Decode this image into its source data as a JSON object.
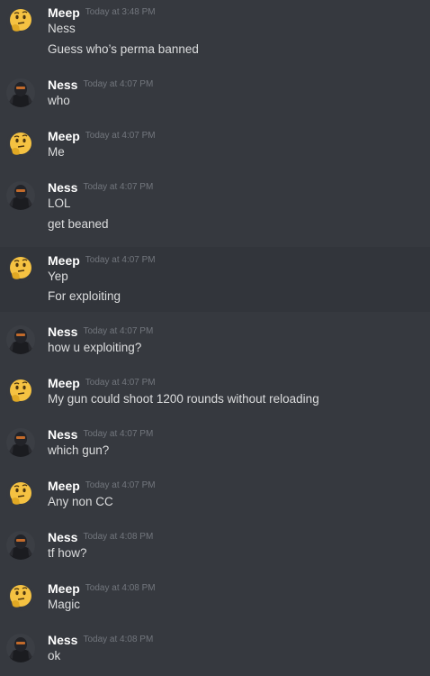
{
  "colors": {
    "background": "#36393f",
    "highlight_row": "#32353b",
    "username": "#ffffff",
    "message_text": "#dcddde",
    "timestamp": "#72767d"
  },
  "messages": [
    {
      "author": "Meep",
      "avatar_icon": "thinking-emoji-icon",
      "timestamp": "Today at 3:48 PM",
      "lines": [
        "Ness",
        "Guess who’s perma banned"
      ]
    },
    {
      "author": "Ness",
      "avatar_icon": "dark-figure-avatar-icon",
      "timestamp": "Today at 4:07 PM",
      "lines": [
        "who"
      ]
    },
    {
      "author": "Meep",
      "avatar_icon": "thinking-emoji-icon",
      "timestamp": "Today at 4:07 PM",
      "lines": [
        "Me"
      ]
    },
    {
      "author": "Ness",
      "avatar_icon": "dark-figure-avatar-icon",
      "timestamp": "Today at 4:07 PM",
      "lines": [
        "LOL",
        "get beaned"
      ]
    },
    {
      "author": "Meep",
      "avatar_icon": "thinking-emoji-icon",
      "timestamp": "Today at 4:07 PM",
      "lines": [
        "Yep",
        "For exploiting"
      ]
    },
    {
      "author": "Ness",
      "avatar_icon": "dark-figure-avatar-icon",
      "timestamp": "Today at 4:07 PM",
      "lines": [
        "how u exploiting?"
      ]
    },
    {
      "author": "Meep",
      "avatar_icon": "thinking-emoji-icon",
      "timestamp": "Today at 4:07 PM",
      "lines": [
        "My gun could shoot 1200 rounds without reloading"
      ]
    },
    {
      "author": "Ness",
      "avatar_icon": "dark-figure-avatar-icon",
      "timestamp": "Today at 4:07 PM",
      "lines": [
        "which gun?"
      ]
    },
    {
      "author": "Meep",
      "avatar_icon": "thinking-emoji-icon",
      "timestamp": "Today at 4:07 PM",
      "lines": [
        "Any non CC"
      ]
    },
    {
      "author": "Ness",
      "avatar_icon": "dark-figure-avatar-icon",
      "timestamp": "Today at 4:08 PM",
      "lines": [
        "tf how?"
      ]
    },
    {
      "author": "Meep",
      "avatar_icon": "thinking-emoji-icon",
      "timestamp": "Today at 4:08 PM",
      "lines": [
        "Magic"
      ]
    },
    {
      "author": "Ness",
      "avatar_icon": "dark-figure-avatar-icon",
      "timestamp": "Today at 4:08 PM",
      "lines": [
        "ok"
      ]
    }
  ]
}
